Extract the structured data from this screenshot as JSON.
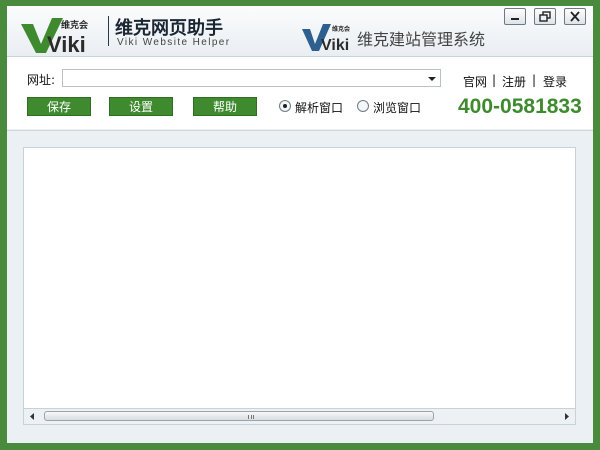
{
  "header": {
    "logo_brand": "维克会",
    "logo_mark": "Viki",
    "app_title": "维克网页助手",
    "app_subtitle": "Viki Website Helper",
    "system_logo_brand": "维克会",
    "system_logo_mark": "Viki",
    "system_title": "维克建站管理系统"
  },
  "window_controls": {
    "minimize_icon": "minimize-icon",
    "restore_icon": "restore-icon",
    "close_icon": "close-icon"
  },
  "toolbar": {
    "url_label": "网址:",
    "url_value": "",
    "buttons": {
      "save": "保存",
      "settings": "设置",
      "help": "帮助"
    },
    "radios": {
      "parse_window": "解析窗口",
      "browse_window": "浏览窗口",
      "selected": "parse_window"
    },
    "links": {
      "official_site": "官网",
      "register": "注册",
      "login": "登录",
      "separator": "|"
    },
    "phone": "400-0581833"
  },
  "colors": {
    "frame_green": "#4a8a3c",
    "button_green": "#3f8a2f",
    "phone_green": "#3f8a2f"
  }
}
